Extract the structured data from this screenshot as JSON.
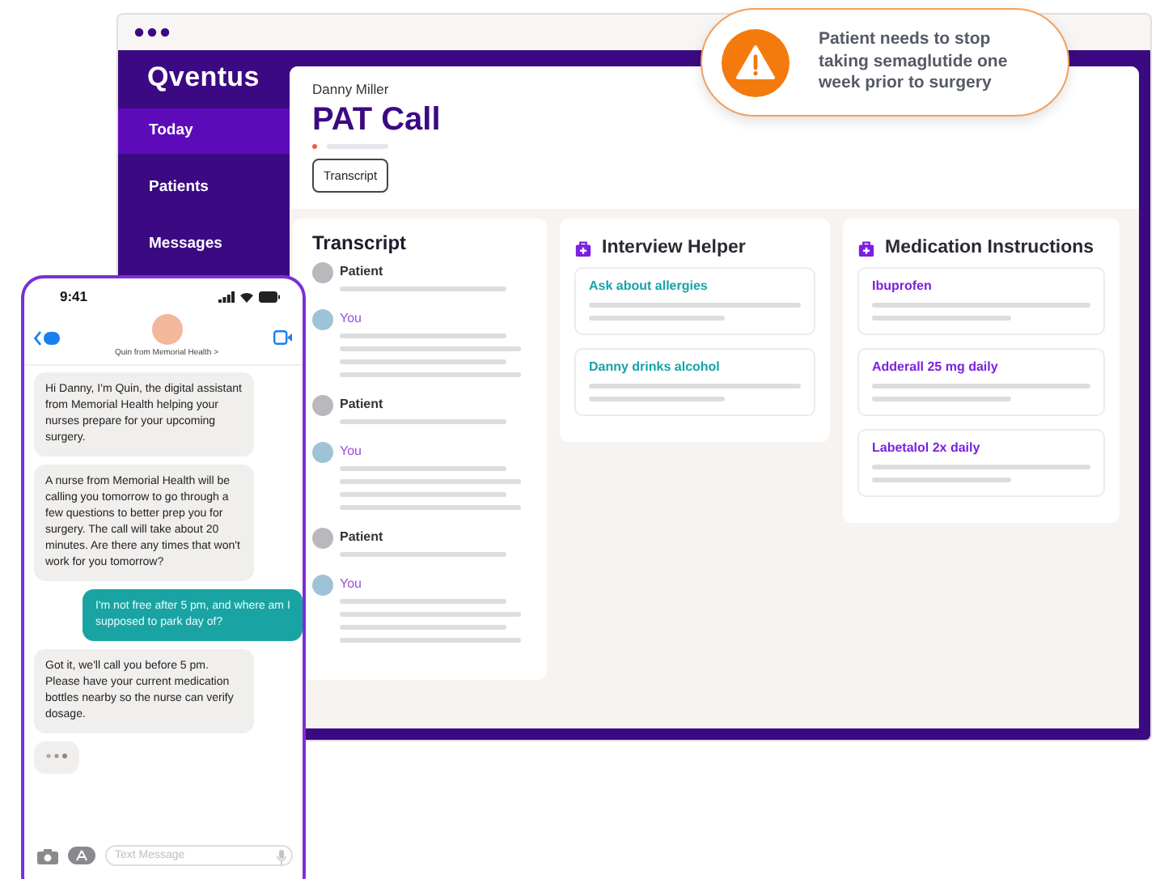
{
  "window": {
    "logo": "Qventus"
  },
  "sidebar": {
    "items": [
      {
        "label": "Today",
        "selected": true
      },
      {
        "label": "Patients",
        "selected": false
      },
      {
        "label": "Messages",
        "selected": false
      }
    ]
  },
  "header": {
    "patient": "Danny Miller",
    "title": "PAT Call",
    "button": "Transcript"
  },
  "transcript": {
    "title": "Transcript",
    "entries": [
      {
        "speaker": "Patient",
        "kind": "patient"
      },
      {
        "speaker": "You",
        "kind": "you"
      },
      {
        "speaker": "Patient",
        "kind": "patient"
      },
      {
        "speaker": "You",
        "kind": "you"
      },
      {
        "speaker": "Patient",
        "kind": "patient"
      },
      {
        "speaker": "You",
        "kind": "you"
      }
    ]
  },
  "interview_helper": {
    "title": "Interview Helper",
    "items": [
      "Ask about allergies",
      "Danny drinks alcohol"
    ]
  },
  "medication_instructions": {
    "title": "Medication Instructions",
    "items": [
      "Ibuprofen",
      "Adderall 25 mg daily",
      "Labetalol 2x daily"
    ]
  },
  "alert": {
    "text": "Patient needs to stop taking semaglutide one week prior to surgery"
  },
  "phone": {
    "time": "9:41",
    "contact": "Quin from Memorial Health >",
    "messages": [
      {
        "kind": "assistant",
        "text": "Hi Danny, I'm Quin, the digital assistant from Memorial Health helping your nurses prepare for your upcoming surgery."
      },
      {
        "kind": "assistant",
        "text": "A nurse from Memorial Health will be calling you tomorrow to go through a few questions to better prep you for surgery. The call will take about 20 minutes. Are there any times that won't work for you tomorrow?"
      },
      {
        "kind": "user",
        "text": "I'm not free after 5 pm, and where am I supposed to park day of?"
      },
      {
        "kind": "assistant",
        "text": "Got it, we'll call you before 5 pm. Please have your current medication bottles nearby so the nurse can verify dosage."
      }
    ],
    "typing": true,
    "placeholder": "Text Message"
  }
}
